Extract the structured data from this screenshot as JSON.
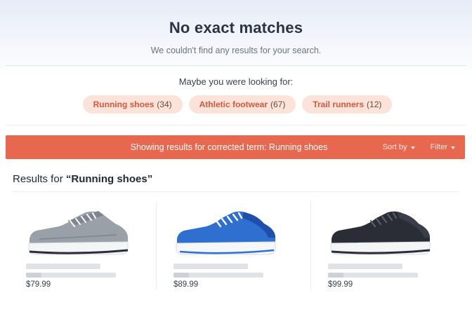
{
  "header": {
    "title": "No exact matches",
    "subtitle": "We couldn't find any results for your search."
  },
  "suggestions": {
    "label": "Maybe you were looking for:",
    "chips": [
      {
        "term": "Running shoes",
        "count": "(34)"
      },
      {
        "term": "Athletic footwear",
        "count": "(67)"
      },
      {
        "term": "Trail runners",
        "count": "(12)"
      }
    ]
  },
  "banner": {
    "text": "Showing results for corrected term: Running shoes",
    "sort_label": "Sort by",
    "filter_label": "Filter",
    "color": "#e7684f"
  },
  "results": {
    "prefix": "Results for ",
    "term": "“Running shoes”",
    "products": [
      {
        "price": "$79.99",
        "icon": "grey-sneaker-image",
        "color": "#9aa0a8"
      },
      {
        "price": "$89.99",
        "icon": "blue-sneaker-image",
        "color": "#2f6fd0"
      },
      {
        "price": "$99.99",
        "icon": "black-sneaker-image",
        "color": "#2a2d35"
      }
    ]
  }
}
